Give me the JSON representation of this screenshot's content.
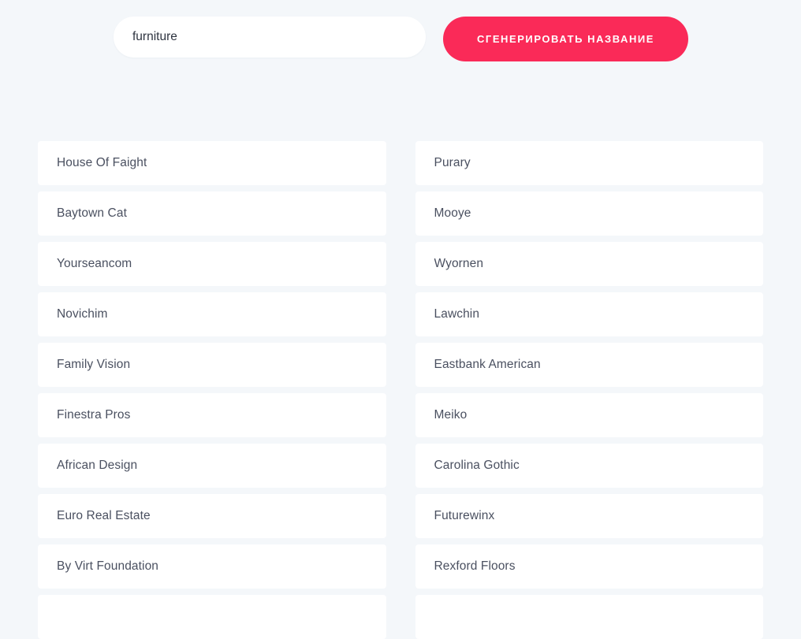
{
  "theme": {
    "page_background": "#f4f7fa",
    "card_background": "#ffffff",
    "accent": "#fa2a58",
    "text": "#4a5060",
    "input_text": "#2e3440"
  },
  "generator": {
    "keyword_value": "furniture",
    "keyword_placeholder": "furniture",
    "generate_label": "СГЕНЕРИРОВАТЬ НАЗВАНИЕ"
  },
  "results": {
    "left_column": [
      {
        "name": "House Of Faight"
      },
      {
        "name": "Baytown Cat"
      },
      {
        "name": "Yourseancom"
      },
      {
        "name": "Novichim"
      },
      {
        "name": "Family Vision"
      },
      {
        "name": "Finestra Pros"
      },
      {
        "name": "African Design"
      },
      {
        "name": "Euro Real Estate"
      },
      {
        "name": "By Virt Foundation"
      },
      {
        "name": ""
      }
    ],
    "right_column": [
      {
        "name": "Purary"
      },
      {
        "name": "Mooye"
      },
      {
        "name": "Wyornen"
      },
      {
        "name": "Lawchin"
      },
      {
        "name": "Eastbank American"
      },
      {
        "name": "Meiko"
      },
      {
        "name": "Carolina Gothic"
      },
      {
        "name": "Futurewinx"
      },
      {
        "name": "Rexford Floors"
      },
      {
        "name": ""
      }
    ]
  }
}
